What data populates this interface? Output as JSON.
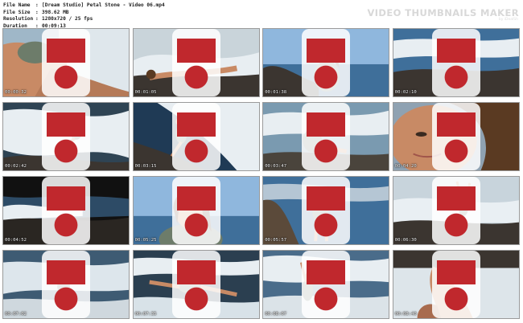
{
  "file_info": {
    "labels": [
      "File Name",
      "File Size",
      "Resolution",
      "Duration"
    ],
    "values": [
      "[Dream Studio] Petal Stone - Video 06.mp4",
      "398.62 MB",
      "1280x720 / 25 fps",
      "00:09:13"
    ],
    "separator": ":"
  },
  "watermark": {
    "title": "VIDEO THUMBNAILS MAKER",
    "subtitle": "by iDealSh"
  },
  "thumbnails": [
    {
      "time": "00:00:32",
      "scene": "pose-closeup"
    },
    {
      "time": "00:01:05",
      "scene": "lying-rocks-surf"
    },
    {
      "time": "00:01:38",
      "scene": "sitting-rock-sky"
    },
    {
      "time": "00:02:10",
      "scene": "sitting-rock-far"
    },
    {
      "time": "00:02:42",
      "scene": "sitting-splash"
    },
    {
      "time": "00:03:15",
      "scene": "water-slide"
    },
    {
      "time": "00:03:47",
      "scene": "crouching-shore"
    },
    {
      "time": "00:04:20",
      "scene": "face-closeup"
    },
    {
      "time": "00:04:52",
      "scene": "dark-rocks-surf"
    },
    {
      "time": "00:05:25",
      "scene": "portrait-sky"
    },
    {
      "time": "00:05:57",
      "scene": "standing-rock"
    },
    {
      "time": "00:06:30",
      "scene": "arms-up-surf"
    },
    {
      "time": "00:07:02",
      "scene": "sitting-surf-left"
    },
    {
      "time": "00:07:35",
      "scene": "lying-water"
    },
    {
      "time": "00:08:07",
      "scene": "kneeling-spray"
    },
    {
      "time": "00:08:40",
      "scene": "feet-closeup"
    }
  ],
  "colors": {
    "sea": "#3f6f9a",
    "foam": "#e8eef2",
    "rock": "#3b3530",
    "sky": "#8fb7dd",
    "skin": "#c88a65",
    "hair": "#5a3a22",
    "swimsuit": "#6d7c6a",
    "badge_red": "#c0282d"
  }
}
